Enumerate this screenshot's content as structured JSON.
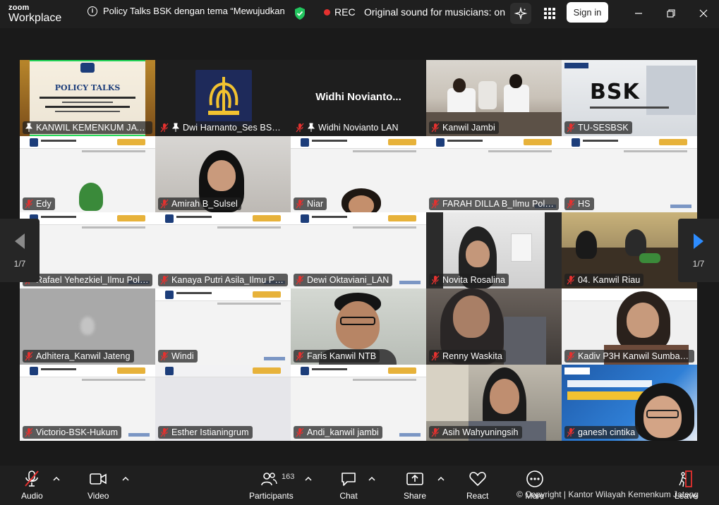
{
  "app": {
    "logo_line1": "zoom",
    "logo_line2": "Workplace",
    "meeting_title": "Policy Talks BSK dengan tema “Mewujudkan",
    "rec_label": "REC",
    "original_sound": "Original sound for musicians: on",
    "sign_in": "Sign in"
  },
  "tiles": [
    {
      "name": "KANWIL KEMENKUM JATE...",
      "pinned": true,
      "muted": false
    },
    {
      "name": "Dwi Harnanto_Ses BSK ...",
      "pinned": true,
      "muted": true
    },
    {
      "name": "Widhi Novianto LAN",
      "pinned": true,
      "muted": true,
      "center_name": "Widhi  Novianto..."
    },
    {
      "name": "Kanwil Jambi",
      "muted": true
    },
    {
      "name": "TU-SESBSK",
      "muted": true
    },
    {
      "name": "Edy",
      "muted": true
    },
    {
      "name": "Amirah B_Sulsel",
      "muted": true
    },
    {
      "name": "Niar",
      "muted": true
    },
    {
      "name": "FARAH DILLA B_Ilmu Politik_...",
      "muted": true
    },
    {
      "name": "HS",
      "muted": true
    },
    {
      "name": "Rafael Yehezkiel_Ilmu Politi...",
      "muted": true
    },
    {
      "name": "Kanaya Putri Asila_Ilmu Poli...",
      "muted": true
    },
    {
      "name": "Dewi Oktaviani_LAN",
      "muted": true
    },
    {
      "name": "Novita Rosalina",
      "muted": true
    },
    {
      "name": "04. Kanwil Riau",
      "muted": true
    },
    {
      "name": "Adhitera_Kanwil Jateng",
      "muted": true
    },
    {
      "name": "Windi",
      "muted": true
    },
    {
      "name": "Faris Kanwil NTB",
      "muted": true
    },
    {
      "name": "Renny Waskita",
      "muted": true
    },
    {
      "name": "Kadiv P3H Kanwil Sumbar_...",
      "muted": true
    },
    {
      "name": "Victorio-BSK-Hukum",
      "muted": true
    },
    {
      "name": "Esther Istianingrum",
      "muted": true
    },
    {
      "name": "Andi_kanwil jambi",
      "muted": true
    },
    {
      "name": "Asih Wahyuningsih",
      "muted": true
    },
    {
      "name": "ganesh cintika",
      "muted": true
    }
  ],
  "slide_texts": {
    "policy_talks": "POLICY TALKS",
    "bsk": "BSK"
  },
  "pager": {
    "left": "1/7",
    "right": "1/7"
  },
  "toolbar": {
    "audio": "Audio",
    "video": "Video",
    "participants": "Participants",
    "participants_count": "163",
    "chat": "Chat",
    "share": "Share",
    "react": "React",
    "more": "More",
    "leave": "Leave"
  },
  "watermark": "© Copyright | Kantor Wilayah Kemenkum Jateng",
  "colors": {
    "active_speaker": "#23d959",
    "rec_dot": "#e5312f",
    "muted_red": "#e5312f",
    "nav_arrow_right": "#2d8cff",
    "shield": "#22c55e"
  }
}
